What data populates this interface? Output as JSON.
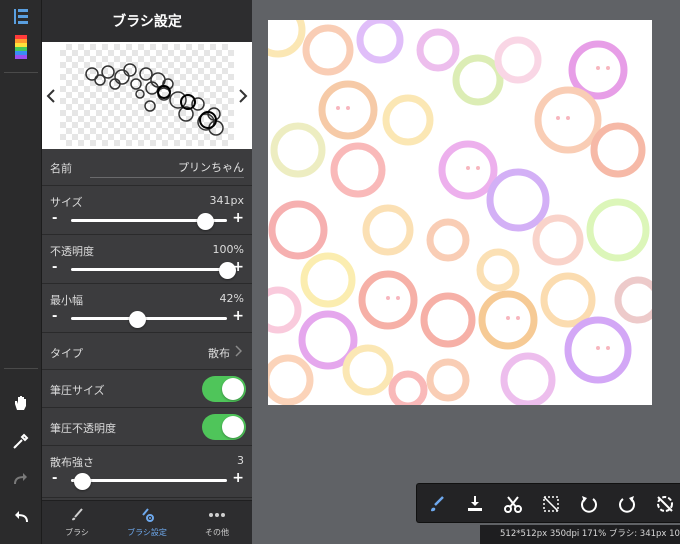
{
  "panel": {
    "title": "ブラシ設定",
    "name_label": "名前",
    "name_value": "プリンちゃん",
    "size_label": "サイズ",
    "size_value": "341px",
    "size_fraction": 0.86,
    "opacity_label": "不透明度",
    "opacity_value": "100%",
    "opacity_fraction": 1.0,
    "minwidth_label": "最小幅",
    "minwidth_value": "42%",
    "minwidth_fraction": 0.42,
    "type_label": "タイプ",
    "type_value": "散布",
    "pressure_size_label": "筆圧サイズ",
    "pressure_size_on": true,
    "pressure_opacity_label": "筆圧不透明度",
    "pressure_opacity_on": true,
    "scatter_label": "散布強さ",
    "scatter_value": "3",
    "scatter_fraction": 0.07
  },
  "tabs": {
    "brush": "ブラシ",
    "brush_settings": "ブラシ設定",
    "other": "その他"
  },
  "status": {
    "text": "512*512px 350dpi 171% ブラシ: 341px 10"
  },
  "colors": {
    "toggle_on": "#4fc55a",
    "active_tab": "#6ea9ee"
  },
  "icons": {
    "layers": "layers-icon",
    "color": "color-palette-icon",
    "hand": "hand-icon",
    "eyedropper": "eyedropper-icon",
    "redo": "redo-icon",
    "undo": "undo-icon"
  }
}
